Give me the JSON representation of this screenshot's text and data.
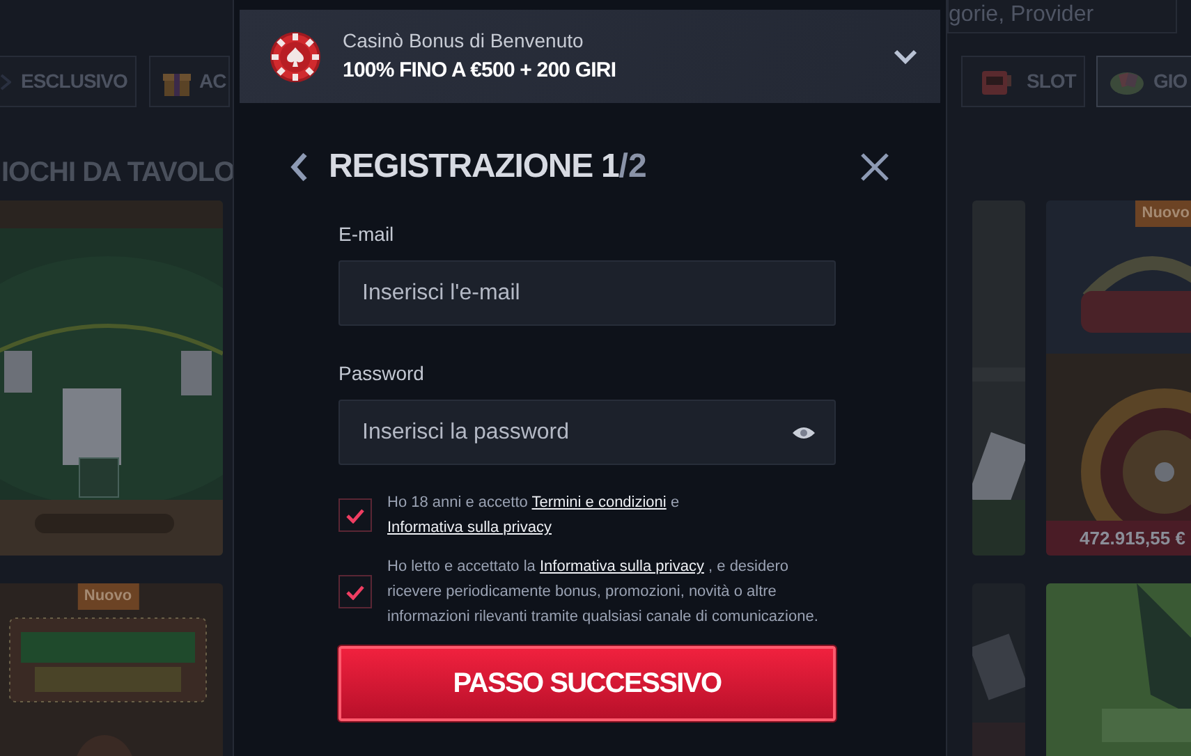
{
  "search": {
    "placeholder": "gorie, Provider"
  },
  "categories": [
    {
      "label": "ESCLUSIVO",
      "selected": false
    },
    {
      "label": "AC",
      "selected": false
    },
    {
      "label": "SLOT",
      "selected": false
    },
    {
      "label": "GIO",
      "selected": true
    }
  ],
  "section_title": "IOCHI DA TAVOLO",
  "games": [
    {
      "kind": "picture"
    },
    {
      "kind": "picture"
    },
    {
      "kind": "picture",
      "badge": "Nuovo",
      "jackpot": "472.915,55 €"
    },
    {
      "kind": "picture",
      "badge": "Nuovo"
    },
    {
      "kind": "picture"
    },
    {
      "kind": "picture"
    }
  ],
  "promo": {
    "title": "Casinò Bonus di Benvenuto",
    "headline": "100% FINO A €500 + 200 GIRI"
  },
  "registration": {
    "title": "REGISTRAZIONE",
    "step_current": "1",
    "step_total": "/2",
    "fields": [
      {
        "kind": "email",
        "label": "E-mail",
        "placeholder": "Inserisci l'e-mail"
      },
      {
        "kind": "password",
        "label": "Password",
        "placeholder": "Inserisci la password"
      }
    ],
    "consents": [
      {
        "checked": true,
        "parts": [
          {
            "kind": "text",
            "text": "Ho 18 anni e accetto"
          },
          {
            "kind": "link",
            "text": "Termini e condizioni"
          },
          {
            "kind": "text",
            "text": "e"
          },
          {
            "kind": "link",
            "text": "Informativa sulla privacy"
          }
        ]
      },
      {
        "checked": true,
        "parts": [
          {
            "kind": "text",
            "text": "Ho letto e accettato la"
          },
          {
            "kind": "link",
            "text": "Informativa sulla privacy"
          },
          {
            "kind": "text",
            "text": ", e desidero ricevere periodicamente bonus, promozioni, novità o altre informazioni rilevanti tramite qualsiasi canale di comunicazione."
          }
        ]
      }
    ],
    "submit": "PASSO SUCCESSIVO"
  }
}
